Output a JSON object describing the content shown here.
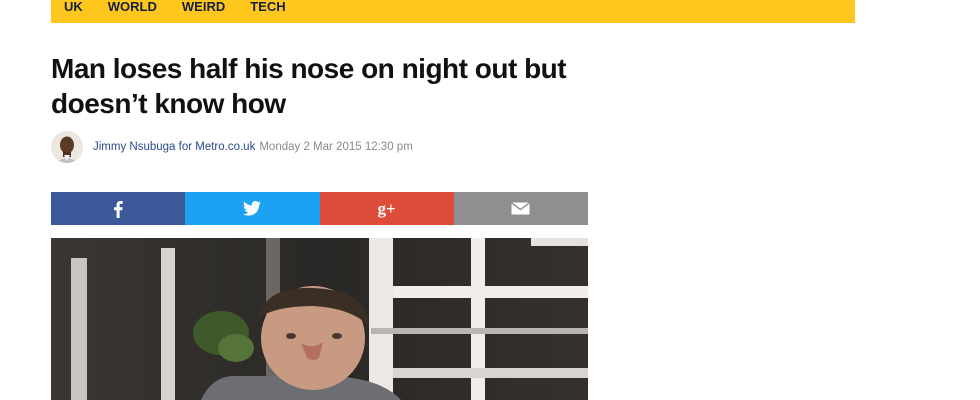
{
  "nav": {
    "items": [
      "UK",
      "WORLD",
      "WEIRD",
      "TECH"
    ],
    "color": "#ffc61e"
  },
  "article": {
    "headline": "Man loses half his nose on night out but doesn’t know how",
    "author": "Jimmy Nsubuga for Metro.co.uk",
    "date": "Monday 2 Mar 2015 12:30 pm"
  },
  "share": {
    "icons": [
      "facebook-icon",
      "twitter-icon",
      "google-plus-icon",
      "email-icon"
    ],
    "colors": {
      "facebook": "#3b5998",
      "twitter": "#1da1f2",
      "google_plus": "#dd4b39",
      "email": "#8f8f8f"
    },
    "google_plus_glyph": "g+"
  }
}
